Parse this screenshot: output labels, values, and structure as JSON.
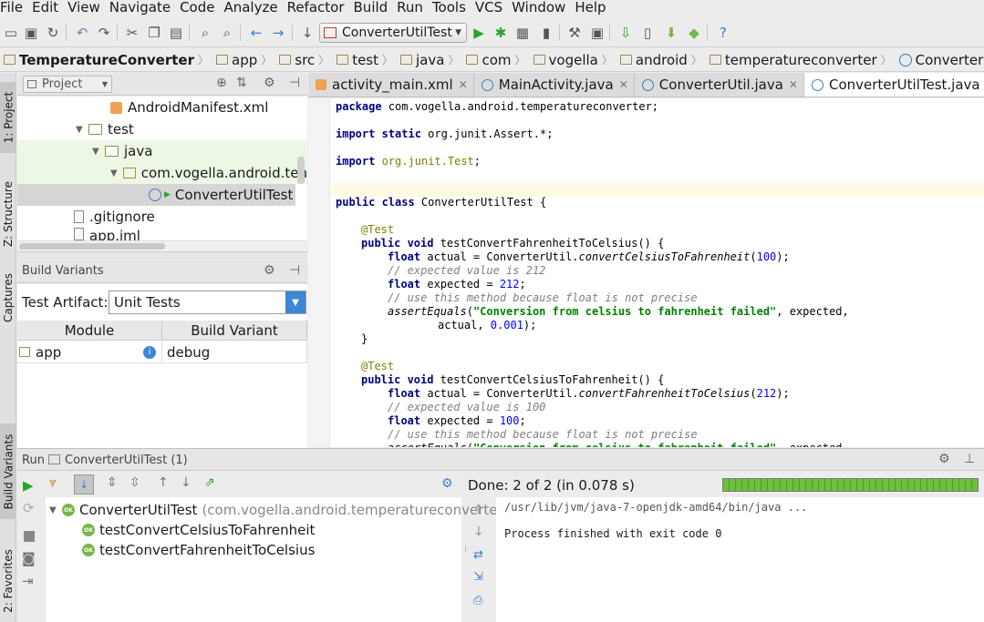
{
  "menu": [
    "File",
    "Edit",
    "View",
    "Navigate",
    "Code",
    "Analyze",
    "Refactor",
    "Build",
    "Run",
    "Tools",
    "VCS",
    "Window",
    "Help"
  ],
  "toolbar": {
    "run_config": "ConverterUtilTest"
  },
  "breadcrumb": [
    "TemperatureConverter",
    "app",
    "src",
    "test",
    "java",
    "com",
    "vogella",
    "android",
    "temperatureconverter",
    "ConverterUtilTest"
  ],
  "side_tabs": {
    "project": "1: Project",
    "structure": "Z: Structure",
    "captures": "Captures",
    "build_variants": "Build Variants",
    "favorites": "2: Favorites"
  },
  "project": {
    "title": "Project",
    "tree": [
      {
        "label": "AndroidManifest.xml"
      },
      {
        "label": "test"
      },
      {
        "label": "java"
      },
      {
        "label": "com.vogella.android.ten"
      },
      {
        "label": "ConverterUtilTest"
      },
      {
        "label": ".gitignore"
      },
      {
        "label": "app.iml"
      }
    ]
  },
  "build_variants": {
    "title": "Build Variants",
    "artifact_label": "Test Artifact:",
    "artifact_value": "Unit Tests",
    "col_module": "Module",
    "col_variant": "Build Variant",
    "module": "app",
    "variant": "debug"
  },
  "tabs": [
    "activity_main.xml",
    "MainActivity.java",
    "ConverterUtil.java",
    "ConverterUtilTest.java",
    "a"
  ],
  "run": {
    "title": "Run",
    "config": "ConverterUtilTest (1)",
    "status": "Done: 2 of 2 (in 0.078 s)",
    "progress": 1.0,
    "root": "ConverterUtilTest",
    "root_pkg": "(com.vogella.android.temperatureconverter",
    "tests": [
      "testConvertCelsiusToFahrenheit",
      "testConvertFahrenheitToCelsius"
    ],
    "ok_badge": "OK",
    "console": [
      "/usr/lib/jvm/java-7-openjdk-amd64/bin/java ...",
      "Process finished with exit code 0"
    ]
  }
}
